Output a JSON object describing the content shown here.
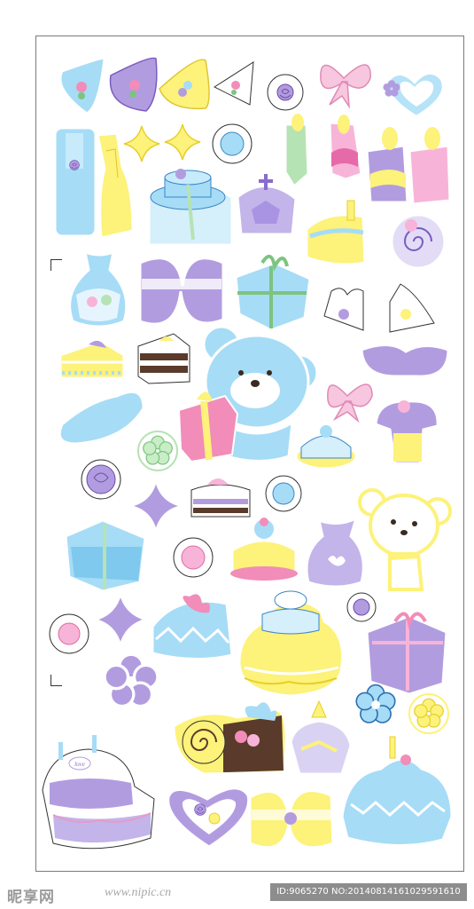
{
  "image": {
    "description_kind": "sticker-sheet",
    "palette": {
      "blue": "#a6dcf6",
      "purple": "#b29ce0",
      "yellow": "#fdf27a",
      "pink": "#f7b4d8",
      "brown": "#5a3a2a",
      "outline": "#2d6fb0"
    }
  },
  "cake_plaque_text": "love",
  "watermark": {
    "brand": "昵享网",
    "url": "www.nipic.cn"
  },
  "id_bar": "ID:9065270 NO:20140814161029591610"
}
